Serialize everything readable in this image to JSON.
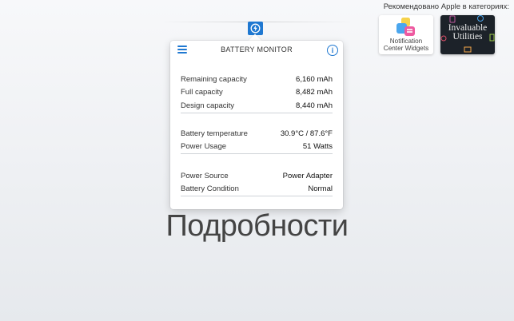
{
  "app": {
    "panel_title": "BATTERY MONITOR"
  },
  "groups": [
    [
      {
        "label": "Remaining capacity",
        "value": "6,160 mAh"
      },
      {
        "label": "Full capacity",
        "value": "8,482 mAh"
      },
      {
        "label": "Design capacity",
        "value": "8,440 mAh"
      }
    ],
    [
      {
        "label": "Battery temperature",
        "value": "30.9°C / 87.6°F"
      },
      {
        "label": "Power Usage",
        "value": "51 Watts"
      }
    ],
    [
      {
        "label": "Power Source",
        "value": "Power Adapter"
      },
      {
        "label": "Battery Condition",
        "value": "Normal"
      }
    ]
  ],
  "page_title": "Подробности",
  "featured": {
    "label": "Рекомендовано Apple в категориях:",
    "tiles": [
      {
        "caption_line1": "Notification",
        "caption_line2": "Center Widgets"
      },
      {
        "caption_line1": "Invaluable",
        "caption_line2": "Utilities"
      }
    ]
  },
  "icons": {
    "status": "battery-monitor-status-icon",
    "menu": "hamburger-menu-icon",
    "info": "info-icon"
  },
  "colors": {
    "accent": "#1f78d1",
    "utilities_tile_bg": "#1c2229"
  }
}
